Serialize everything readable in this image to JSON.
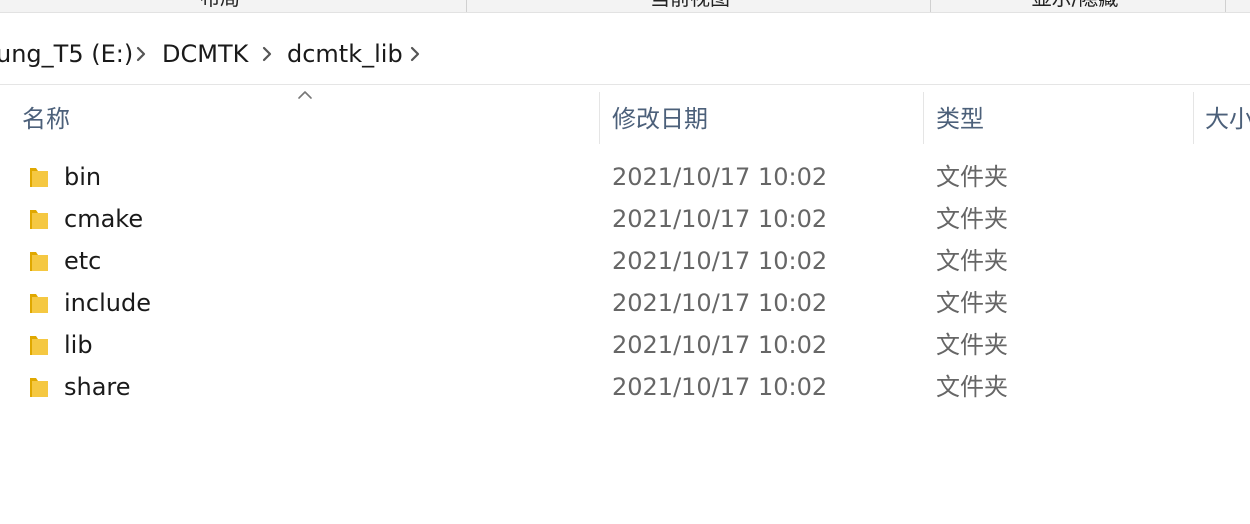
{
  "ribbon": {
    "tabs": [
      "布局",
      "当前视图",
      "显示/隐藏"
    ]
  },
  "address": {
    "crumbs": [
      "ung_T5 (E:)",
      "DCMTK",
      "dcmtk_lib"
    ]
  },
  "columns": {
    "name": "名称",
    "modified": "修改日期",
    "type": "类型",
    "size": "大小"
  },
  "files": [
    {
      "name": "bin",
      "modified": "2021/10/17 10:02",
      "type": "文件夹"
    },
    {
      "name": "cmake",
      "modified": "2021/10/17 10:02",
      "type": "文件夹"
    },
    {
      "name": "etc",
      "modified": "2021/10/17 10:02",
      "type": "文件夹"
    },
    {
      "name": "include",
      "modified": "2021/10/17 10:02",
      "type": "文件夹"
    },
    {
      "name": "lib",
      "modified": "2021/10/17 10:02",
      "type": "文件夹"
    },
    {
      "name": "share",
      "modified": "2021/10/17 10:02",
      "type": "文件夹"
    }
  ],
  "icons": {
    "folder": "folder-icon",
    "chevron": "chevron-right-icon",
    "sort": "sort-ascending-icon"
  },
  "colors": {
    "header_text": "#4c607a",
    "folder_yellow": "#f5c842",
    "secondary_text": "#666666"
  }
}
